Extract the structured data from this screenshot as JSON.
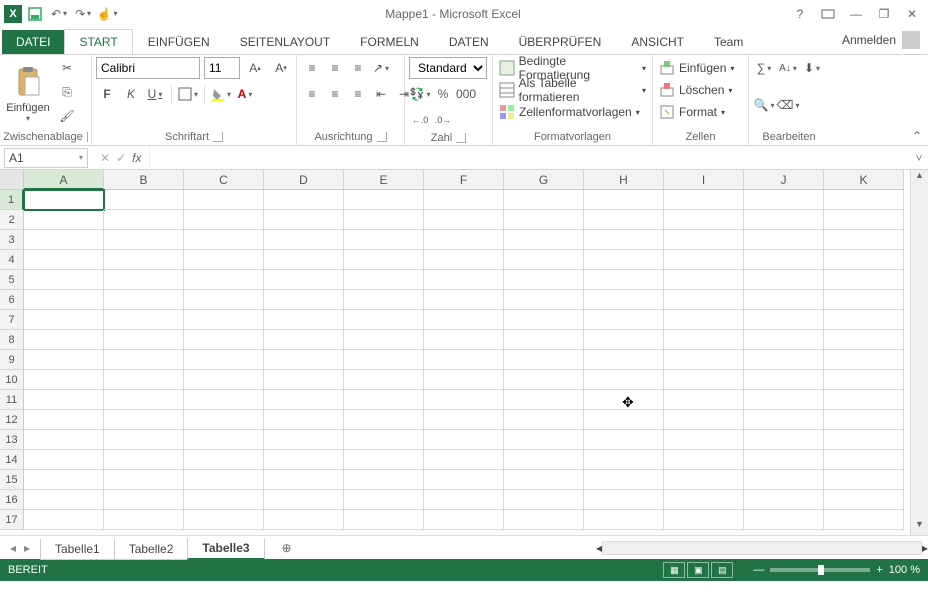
{
  "title": "Mappe1 - Microsoft Excel",
  "qat": {
    "save": "💾",
    "undo": "↶",
    "redo": "↷",
    "touch": "✋"
  },
  "wincontrols": {
    "help": "?",
    "displayopts": "▭",
    "min": "—",
    "restore": "❐",
    "close": "✕"
  },
  "tabs": {
    "file": "DATEI",
    "items": [
      "START",
      "EINFÜGEN",
      "SEITENLAYOUT",
      "FORMELN",
      "DATEN",
      "ÜBERPRÜFEN",
      "ANSICHT",
      "Team"
    ],
    "active": 0,
    "signin": "Anmelden"
  },
  "ribbon": {
    "clipboard": {
      "label": "Zwischenablage",
      "paste": "Einfügen"
    },
    "font": {
      "label": "Schriftart",
      "name": "Calibri",
      "size": "11",
      "bold": "F",
      "italic": "K",
      "underline": "U"
    },
    "alignment": {
      "label": "Ausrichtung"
    },
    "number": {
      "label": "Zahl",
      "format": "Standard"
    },
    "styles": {
      "label": "Formatvorlagen",
      "cond": "Bedingte Formatierung",
      "table": "Als Tabelle formatieren",
      "cell": "Zellenformatvorlagen"
    },
    "cells": {
      "label": "Zellen",
      "insert": "Einfügen",
      "delete": "Löschen",
      "format": "Format"
    },
    "editing": {
      "label": "Bearbeiten"
    }
  },
  "formulabar": {
    "namebox": "A1",
    "fx": "fx"
  },
  "grid": {
    "columns": [
      "A",
      "B",
      "C",
      "D",
      "E",
      "F",
      "G",
      "H",
      "I",
      "J",
      "K"
    ],
    "rows": 17,
    "active": "A1"
  },
  "sheets": {
    "items": [
      "Tabelle1",
      "Tabelle2",
      "Tabelle3"
    ],
    "active": 2
  },
  "status": {
    "ready": "BEREIT",
    "zoom": "100 %"
  }
}
